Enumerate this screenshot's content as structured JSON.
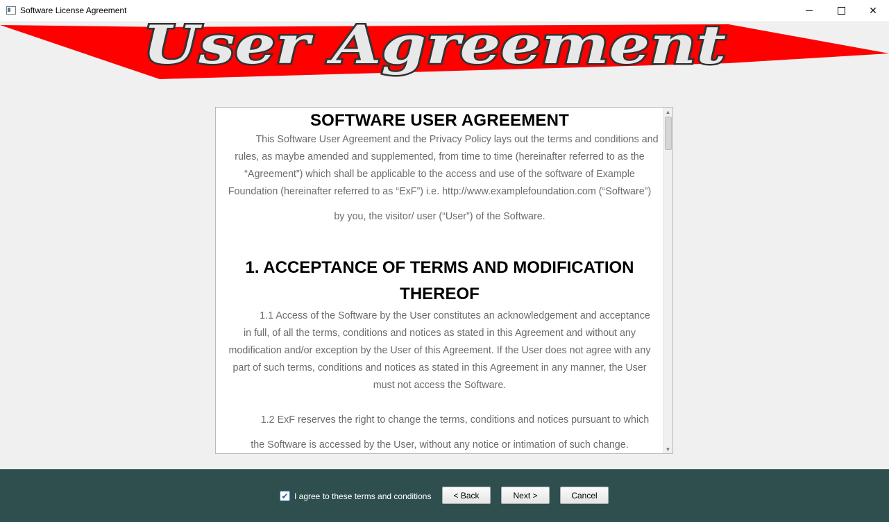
{
  "window": {
    "title": "Software License Agreement",
    "minimize_icon": "minimize-icon",
    "maximize_icon": "maximize-icon",
    "close_glyph": "✕"
  },
  "banner": {
    "text": "User Agreement",
    "ribbon_color": "#ff0000",
    "text_fill": "#e8e8e8",
    "text_outline": "#333333"
  },
  "document": {
    "title": "SOFTWARE USER AGREEMENT",
    "intro_lines": [
      "This Software User Agreement and the Privacy Policy lays out the terms and conditions and rules, as maybe amended and supplemented, from time to time (hereinafter referred to as the “Agreement”) which shall be applicable to the access and use of the software of Example Foundation (hereinafter referred to as “ExF”) i.e. http://www.examplefoundation.com (“Software”)",
      "by you, the visitor/ user (“User”) of the Software."
    ],
    "section1_heading": "1. ACCEPTANCE OF TERMS AND MODIFICATION THEREOF",
    "section1_p1": "1.1 Access of the Software by the User constitutes an acknowledgement and acceptance in full, of all the terms, conditions and notices as stated in this Agreement and without any modification and/or exception by the User of this Agreement. If the User does not agree with any part of such terms, conditions and notices as stated in this Agreement in any manner, the User must not access the Software.",
    "section1_p2": "1.2 ExF reserves the right to change the terms, conditions and notices pursuant to which",
    "section1_p2_tail": "the Software is accessed by the User, without any notice or intimation of such change."
  },
  "footer": {
    "agree_label": "I agree to these terms and conditions",
    "agree_checked": true,
    "back_label": "< Back",
    "next_label": "Next >",
    "cancel_label": "Cancel",
    "background": "#2f4f4f"
  }
}
